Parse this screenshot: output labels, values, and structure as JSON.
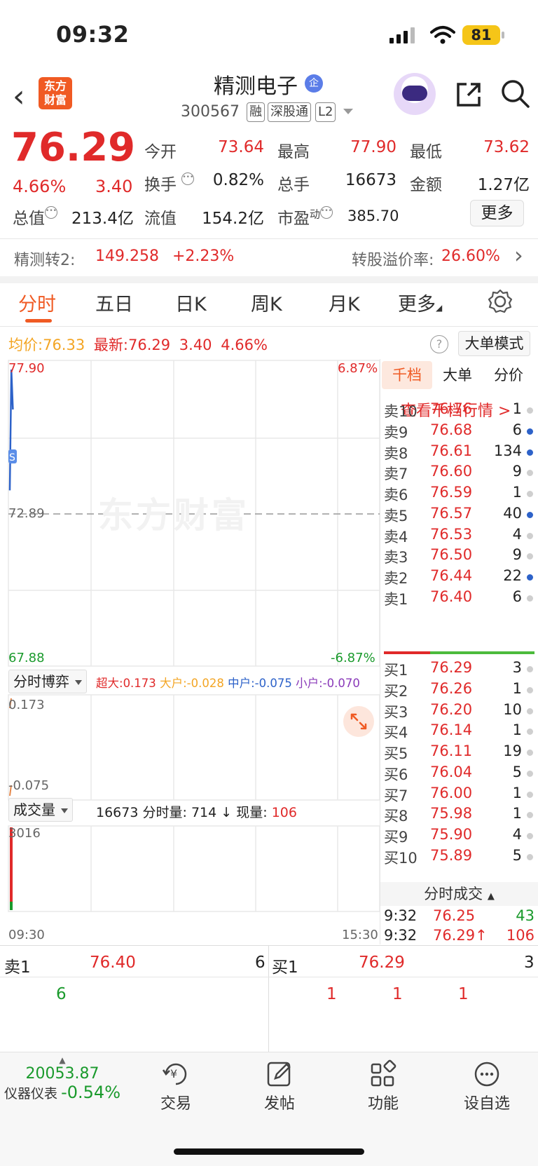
{
  "status_bar": {
    "time": "09:32",
    "battery": "81"
  },
  "header": {
    "stock_name": "精测电子",
    "verified_badge": "企",
    "logo_text": "东方财富",
    "code": "300567",
    "tags": [
      "融",
      "深股通",
      "L2"
    ]
  },
  "quote": {
    "price": "76.29",
    "pct": "4.66%",
    "change": "3.40",
    "fields": [
      {
        "label": "今开",
        "value": "73.64",
        "color": "red"
      },
      {
        "label": "最高",
        "value": "77.90",
        "color": "red"
      },
      {
        "label": "最低",
        "value": "73.62",
        "color": "red"
      },
      {
        "label": "换手",
        "value": "0.82%",
        "color": "dark"
      },
      {
        "label": "总手",
        "value": "16673",
        "color": "dark"
      },
      {
        "label": "金额",
        "value": "1.27亿",
        "color": "dark"
      },
      {
        "label": "总值",
        "value": "213.4亿",
        "color": "dark"
      },
      {
        "label": "流值",
        "value": "154.2亿",
        "color": "dark"
      },
      {
        "label": "市盈",
        "value": "385.70",
        "color": "dark"
      }
    ],
    "pe_superscript": "动",
    "more_button": "更多"
  },
  "bond": {
    "label": "精测转2:",
    "price": "149.258",
    "change": "+2.23%",
    "premium_label": "转股溢价率:",
    "premium_value": "26.60%"
  },
  "tabs": [
    "分时",
    "五日",
    "日K",
    "周K",
    "月K",
    "更多"
  ],
  "active_tab": "分时",
  "info_line": {
    "avg_label": "均价:",
    "avg_value": "76.33",
    "latest_label": "最新:",
    "latest_value": "76.29",
    "latest_change": "3.40",
    "latest_pct": "4.66%",
    "big_order_mode": "大单模式"
  },
  "chart": {
    "y_high": "77.90",
    "y_mid": "72.89",
    "y_low": "67.88",
    "pct_high": "6.87%",
    "pct_low": "-6.87%",
    "watermark": "东方财富",
    "time_start": "09:30",
    "time_end": "15:30"
  },
  "chart_data": {
    "type": "line",
    "x": [
      "09:30",
      "09:31",
      "09:32"
    ],
    "series": [],
    "values": [
      73.64,
      77.6,
      76.29
    ],
    "ylim": [
      67.88,
      77.9
    ],
    "reference": 72.89
  },
  "game_panel": {
    "title": "分时博弈",
    "super_label": "超大:",
    "super_value": "0.173",
    "big_label": "大户:",
    "big_value": "-0.028",
    "mid_label": "中户:",
    "mid_value": "-0.075",
    "small_label": "小户:",
    "small_value": "-0.070",
    "y_top": "0.173",
    "y_bottom": "-0.075"
  },
  "volume_panel": {
    "title": "成交量",
    "total": "16673",
    "minute_label": "分时量:",
    "minute_value": "714",
    "arrow": "↓",
    "current_label": "现量:",
    "current_value": "106",
    "y_top": "3016"
  },
  "order_book": {
    "tabs": [
      "千档",
      "大单",
      "分价"
    ],
    "link": "查看千档行情 >",
    "asks": [
      {
        "label": "卖10",
        "price": "76.76",
        "vol": "1",
        "dot": "gray"
      },
      {
        "label": "卖9",
        "price": "76.68",
        "vol": "6",
        "dot": "blue"
      },
      {
        "label": "卖8",
        "price": "76.61",
        "vol": "134",
        "dot": "blue"
      },
      {
        "label": "卖7",
        "price": "76.60",
        "vol": "9",
        "dot": "gray"
      },
      {
        "label": "卖6",
        "price": "76.59",
        "vol": "1",
        "dot": "gray"
      },
      {
        "label": "卖5",
        "price": "76.57",
        "vol": "40",
        "dot": "blue"
      },
      {
        "label": "卖4",
        "price": "76.53",
        "vol": "4",
        "dot": "gray"
      },
      {
        "label": "卖3",
        "price": "76.50",
        "vol": "9",
        "dot": "gray"
      },
      {
        "label": "卖2",
        "price": "76.44",
        "vol": "22",
        "dot": "blue"
      },
      {
        "label": "卖1",
        "price": "76.40",
        "vol": "6",
        "dot": "gray"
      }
    ],
    "bids": [
      {
        "label": "买1",
        "price": "76.29",
        "vol": "3",
        "dot": "gray"
      },
      {
        "label": "买2",
        "price": "76.26",
        "vol": "1",
        "dot": "gray"
      },
      {
        "label": "买3",
        "price": "76.20",
        "vol": "10",
        "dot": "gray"
      },
      {
        "label": "买4",
        "price": "76.14",
        "vol": "1",
        "dot": "gray"
      },
      {
        "label": "买5",
        "price": "76.11",
        "vol": "19",
        "dot": "gray"
      },
      {
        "label": "买6",
        "price": "76.04",
        "vol": "5",
        "dot": "gray"
      },
      {
        "label": "买7",
        "price": "76.00",
        "vol": "1",
        "dot": "gray"
      },
      {
        "label": "买8",
        "price": "75.98",
        "vol": "1",
        "dot": "gray"
      },
      {
        "label": "买9",
        "price": "75.90",
        "vol": "4",
        "dot": "gray"
      },
      {
        "label": "买10",
        "price": "75.89",
        "vol": "5",
        "dot": "gray"
      }
    ]
  },
  "ticks": {
    "title": "分时成交",
    "rows": [
      {
        "time": "9:32",
        "price": "76.25",
        "vol": "43",
        "vol_color": "green",
        "arrow": ""
      },
      {
        "time": "9:32",
        "price": "76.29",
        "vol": "106",
        "vol_color": "red",
        "arrow": "↑"
      }
    ]
  },
  "bottom_quick": {
    "ask_label": "卖1",
    "ask_price": "76.40",
    "ask_vol": "6",
    "bid_label": "买1",
    "bid_price": "76.29",
    "bid_vol": "3",
    "ask_queue": [
      "6"
    ],
    "bid_queue": [
      "1",
      "1",
      "1"
    ]
  },
  "nav": {
    "index_value": "20053.87",
    "index_name": "仪器仪表",
    "index_change": "-0.54%",
    "items": [
      {
        "label": "交易",
        "icon": "trade-yen-icon"
      },
      {
        "label": "发帖",
        "icon": "edit-icon"
      },
      {
        "label": "功能",
        "icon": "grid-icon"
      },
      {
        "label": "设自选",
        "icon": "more-dots-icon"
      }
    ]
  },
  "colors": {
    "up": "#e02a2a",
    "down": "#1a9a2c",
    "accent": "#f05a23",
    "avg": "#f3a524"
  }
}
